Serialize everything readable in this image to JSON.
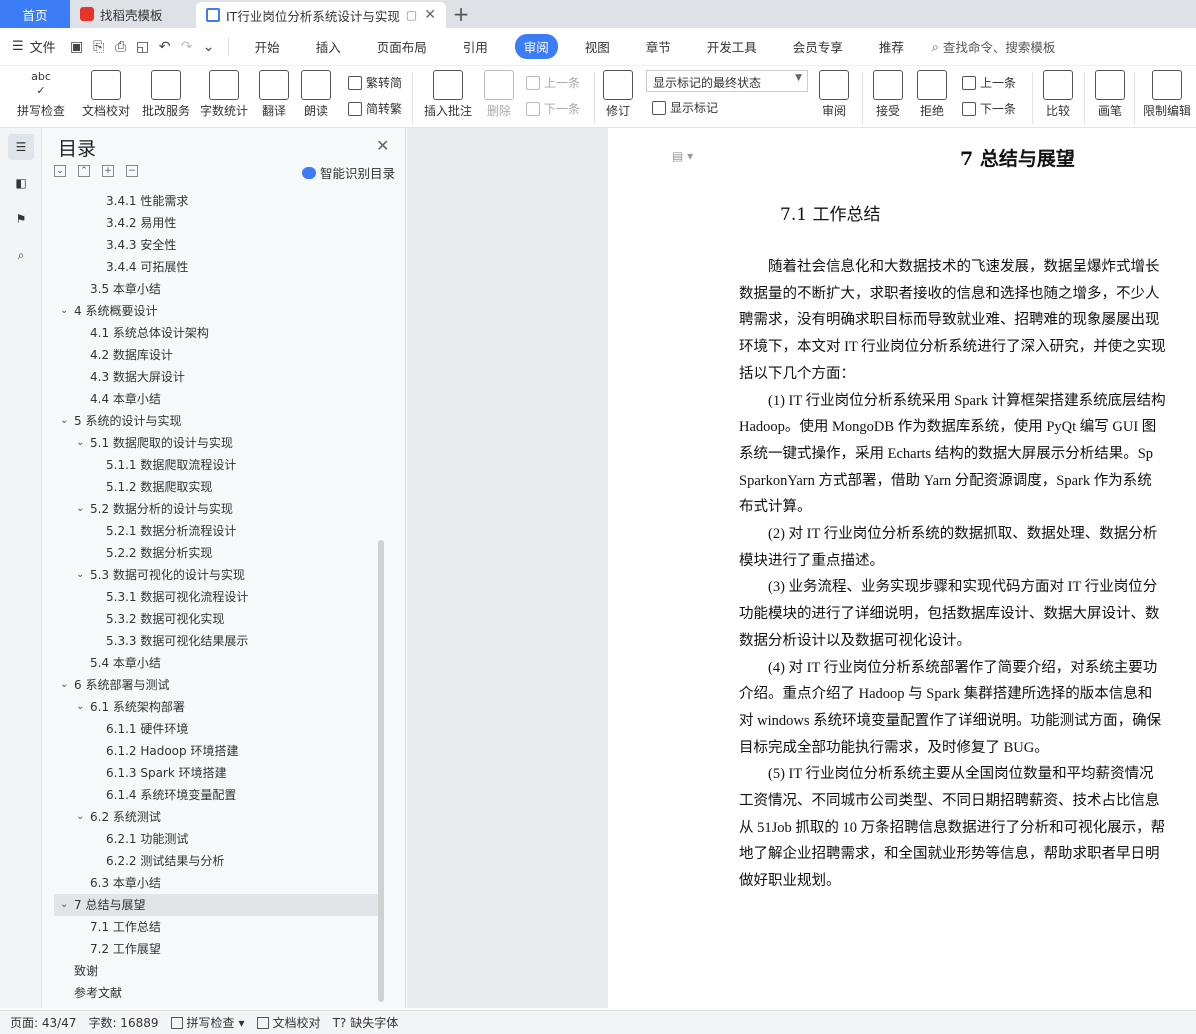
{
  "tabs": {
    "home": "首页",
    "template": "找稻壳模板",
    "document": "IT行业岗位分析系统设计与实现",
    "new": "+"
  },
  "menubar": {
    "file": "文件",
    "tabs": [
      "开始",
      "插入",
      "页面布局",
      "引用",
      "审阅",
      "视图",
      "章节",
      "开发工具",
      "会员专享",
      "推荐"
    ],
    "active_tab": "审阅",
    "search": "查找命令、搜索模板"
  },
  "ribbon": {
    "spell": "拼写检查",
    "proof": "文档校对",
    "batch": "批改服务",
    "wordcount": "字数统计",
    "translate": "翻译",
    "read": "朗读",
    "trad": "繁转简",
    "simp": "简转繁",
    "insert_comment": "插入批注",
    "delete": "删除",
    "prev": "上一条",
    "next": "下一条",
    "revise": "修订",
    "display_state": "显示标记的最终状态",
    "show_marks": "显示标记",
    "review": "审阅",
    "accept": "接受",
    "reject": "拒绝",
    "prev2": "上一条",
    "next2": "下一条",
    "compare": "比较",
    "pen": "画笔",
    "restrict": "限制编辑"
  },
  "toc": {
    "title": "目录",
    "ai_label": "智能识别目录",
    "items": [
      {
        "text": "3.4.1  性能需求",
        "level": 3
      },
      {
        "text": "3.4.2  易用性",
        "level": 3
      },
      {
        "text": "3.4.3  安全性",
        "level": 3
      },
      {
        "text": "3.4.4  可拓展性",
        "level": 3
      },
      {
        "text": "3.5  本章小结",
        "level": 2
      },
      {
        "text": "4  系统概要设计",
        "level": 1,
        "chev": true
      },
      {
        "text": "4.1  系统总体设计架构",
        "level": 2
      },
      {
        "text": "4.2  数据库设计",
        "level": 2
      },
      {
        "text": "4.3  数据大屏设计",
        "level": 2
      },
      {
        "text": "4.4  本章小结",
        "level": 2
      },
      {
        "text": "5  系统的设计与实现",
        "level": 1,
        "chev": true
      },
      {
        "text": "5.1  数据爬取的设计与实现",
        "level": 2,
        "chev": true
      },
      {
        "text": "5.1.1  数据爬取流程设计",
        "level": 3
      },
      {
        "text": "5.1.2  数据爬取实现",
        "level": 3
      },
      {
        "text": "5.2  数据分析的设计与实现",
        "level": 2,
        "chev": true
      },
      {
        "text": "5.2.1  数据分析流程设计",
        "level": 3
      },
      {
        "text": "5.2.2  数据分析实现",
        "level": 3
      },
      {
        "text": "5.3  数据可视化的设计与实现",
        "level": 2,
        "chev": true
      },
      {
        "text": "5.3.1  数据可视化流程设计",
        "level": 3
      },
      {
        "text": "5.3.2  数据可视化实现",
        "level": 3
      },
      {
        "text": "5.3.3  数据可视化结果展示",
        "level": 3
      },
      {
        "text": "5.4  本章小结",
        "level": 2
      },
      {
        "text": "6  系统部署与测试",
        "level": 1,
        "chev": true
      },
      {
        "text": "6.1  系统架构部署",
        "level": 2,
        "chev": true
      },
      {
        "text": "6.1.1  硬件环境",
        "level": 3
      },
      {
        "text": "6.1.2 Hadoop 环境搭建",
        "level": 3
      },
      {
        "text": "6.1.3 Spark 环境搭建",
        "level": 3
      },
      {
        "text": "6.1.4  系统环境变量配置",
        "level": 3
      },
      {
        "text": "6.2  系统测试",
        "level": 2,
        "chev": true
      },
      {
        "text": "6.2.1  功能测试",
        "level": 3
      },
      {
        "text": "6.2.2  测试结果与分析",
        "level": 3
      },
      {
        "text": "6.3  本章小结",
        "level": 2
      },
      {
        "text": "7  总结与展望",
        "level": 1,
        "chev": true,
        "selected": true
      },
      {
        "text": "7.1  工作总结",
        "level": 2
      },
      {
        "text": "7.2  工作展望",
        "level": 2
      },
      {
        "text": "致谢",
        "level": 1
      },
      {
        "text": "参考文献",
        "level": 1
      }
    ]
  },
  "document": {
    "heading1": "7  总结与展望",
    "heading2": "7.1  工作总结",
    "lines": [
      "　　随着社会信息化和大数据技术的飞速发展，数据呈爆炸式增长",
      "数据量的不断扩大，求职者接收的信息和选择也随之增多，不少人",
      "聘需求，没有明确求职目标而导致就业难、招聘难的现象屡屡出现",
      "环境下，本文对 IT 行业岗位分析系统进行了深入研究，并使之实现",
      "括以下几个方面：",
      "　　(1) IT 行业岗位分析系统采用 Spark 计算框架搭建系统底层结构",
      "Hadoop。使用 MongoDB 作为数据库系统，使用 PyQt 编写 GUI 图",
      "系统一键式操作，采用 Echarts 结构的数据大屏展示分析结果。Sp",
      "SparkonYarn 方式部署，借助 Yarn 分配资源调度，Spark 作为系统",
      "布式计算。",
      "　　(2)  对 IT 行业岗位分析系统的数据抓取、数据处理、数据分析",
      "模块进行了重点描述。",
      "　　(3)  业务流程、业务实现步骤和实现代码方面对 IT 行业岗位分",
      "功能模块的进行了详细说明，包括数据库设计、数据大屏设计、数",
      "数据分析设计以及数据可视化设计。",
      "　　(4)  对 IT 行业岗位分析系统部署作了简要介绍，对系统主要功",
      "介绍。重点介绍了 Hadoop 与 Spark 集群搭建所选择的版本信息和",
      "对 windows 系统环境变量配置作了详细说明。功能测试方面，确保",
      "目标完成全部功能执行需求，及时修复了 BUG。",
      "　　(5) IT 行业岗位分析系统主要从全国岗位数量和平均薪资情况",
      "工资情况、不同城市公司类型、不同日期招聘薪资、技术占比信息",
      "从 51Job 抓取的 10 万条招聘信息数据进行了分析和可视化展示，帮",
      "地了解企业招聘需求，和全国就业形势等信息，帮助求职者早日明",
      "做好职业规划。"
    ]
  },
  "status": {
    "page": "页面: 43/47",
    "words": "字数: 16889",
    "spell": "拼写检查",
    "proof": "文档校对",
    "missing_font": "缺失字体"
  },
  "colors": {
    "accent": "#3c7cf5",
    "toc_selected": "#e2e4e8"
  }
}
